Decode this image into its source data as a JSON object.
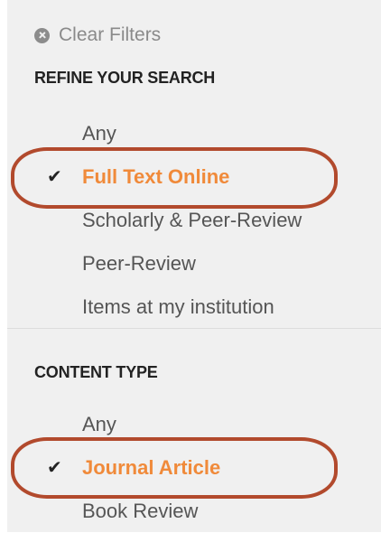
{
  "clear_filters": {
    "label": "Clear Filters",
    "icon": "close-circle-icon"
  },
  "refine": {
    "title": "REFINE YOUR SEARCH",
    "items": [
      {
        "label": "Any",
        "selected": false
      },
      {
        "label": "Full Text Online",
        "selected": true
      },
      {
        "label": "Scholarly & Peer-Review",
        "selected": false
      },
      {
        "label": "Peer-Review",
        "selected": false
      },
      {
        "label": "Items at my institution",
        "selected": false
      }
    ]
  },
  "content_type": {
    "title": "CONTENT TYPE",
    "items": [
      {
        "label": "Any",
        "selected": false
      },
      {
        "label": "Journal Article",
        "selected": true
      },
      {
        "label": "Book Review",
        "selected": false
      }
    ]
  },
  "colors": {
    "panel_bg": "#f0f0f0",
    "selected_text": "#f08a3a",
    "annotation_ring": "#b24a2d"
  },
  "icons": {
    "check": "✔"
  }
}
